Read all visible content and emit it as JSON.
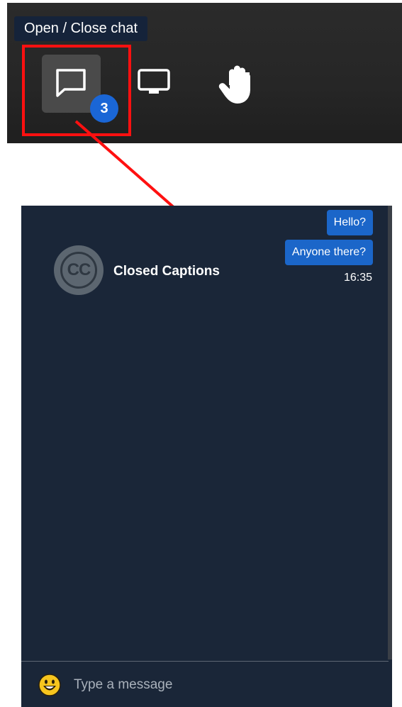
{
  "toolbar": {
    "tooltip": "Open / Close chat",
    "chat_badge_count": "3",
    "icons": [
      "chat-bubble-icon",
      "screen-share-icon",
      "raise-hand-icon"
    ]
  },
  "annotation": {
    "highlight_color": "#ff1010"
  },
  "chat": {
    "messages": [
      {
        "text": "Hello?"
      },
      {
        "text": "Anyone there?"
      }
    ],
    "last_timestamp": "16:35",
    "participant": {
      "avatar_text": "CC",
      "name": "Closed Captions"
    },
    "composer": {
      "placeholder": "Type a message"
    }
  },
  "colors": {
    "panel_bg": "#1a2638",
    "bubble_bg": "#1b66c9",
    "badge_bg": "#1a66d6"
  }
}
